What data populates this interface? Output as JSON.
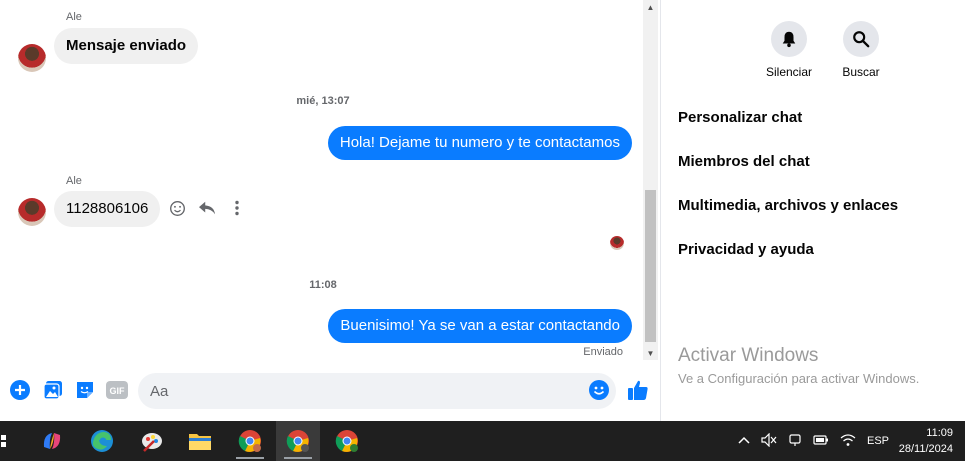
{
  "messages": {
    "sender_name": "Ale",
    "incoming_1": "Mensaje enviado",
    "timestamp_1": "mié, 13:07",
    "outgoing_1": "Hola! Dejame tu numero y te contactamos",
    "incoming_2": "1128806106",
    "timestamp_2": "11:08",
    "outgoing_2": "Buenisimo! Ya se van a estar contactando",
    "status": "Enviado"
  },
  "composer": {
    "placeholder": "Aa"
  },
  "info_panel": {
    "mute_label": "Silenciar",
    "search_label": "Buscar",
    "sections": [
      "Personalizar chat",
      "Miembros del chat",
      "Multimedia, archivos y enlaces",
      "Privacidad y ayuda"
    ]
  },
  "watermark": {
    "title": "Activar Windows",
    "subtitle": "Ve a Configuración para activar Windows."
  },
  "taskbar": {
    "language": "ESP",
    "time": "11:09",
    "date": "28/11/2024"
  },
  "colors": {
    "accent": "#0a7cff",
    "incoming_bubble": "#f0f0f0",
    "taskbar": "#1f1f1f"
  }
}
